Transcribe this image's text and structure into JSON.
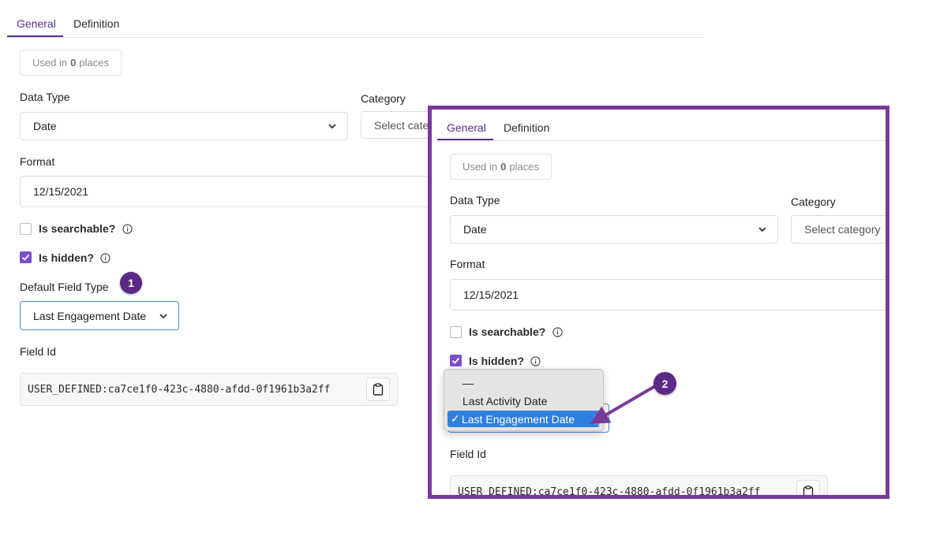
{
  "tabs": {
    "general": "General",
    "definition": "Definition"
  },
  "usage": {
    "prefix": "Used in",
    "count": "0",
    "suffix": "places"
  },
  "data_type": {
    "label": "Data Type",
    "value": "Date"
  },
  "category": {
    "label": "Category",
    "placeholder_short": "Select cate",
    "placeholder": "Select category"
  },
  "format": {
    "label": "Format",
    "value": "12/15/2021"
  },
  "searchable": {
    "label": "Is searchable?",
    "checked": false
  },
  "hidden": {
    "label": "Is hidden?",
    "checked": true
  },
  "default_field_type": {
    "label": "Default Field Type",
    "value": "Last Engagement Date"
  },
  "field_id": {
    "label": "Field Id",
    "value": "USER_DEFINED:ca7ce1f0-423c-4880-afdd-0f1961b3a2ff"
  },
  "dropdown": {
    "options": [
      "—",
      "Last Activity Date",
      "Last Engagement Date"
    ],
    "selected": "Last Engagement Date",
    "checkmark": "✓"
  },
  "callouts": [
    "1",
    "2"
  ],
  "colors": {
    "accent": "#5b2d91",
    "frame": "#7a3a9a",
    "callout": "#5c2a86",
    "selection": "#2f7fe0"
  }
}
